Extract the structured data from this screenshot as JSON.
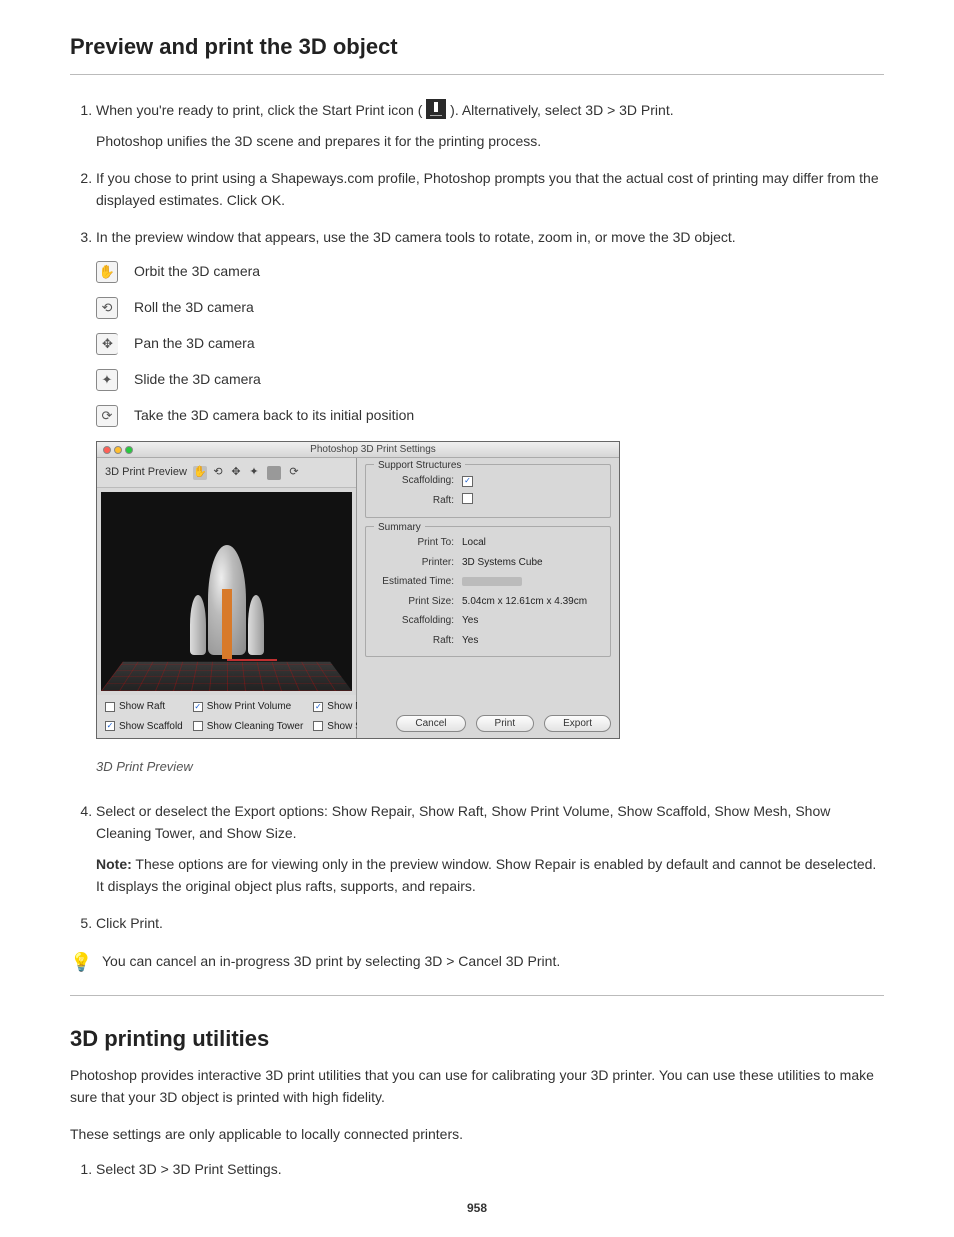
{
  "section1": {
    "title": "Preview and print the 3D object",
    "steps": [
      {
        "pre": "When you're ready to print, click the Start Print icon (",
        "post": " ). Alternatively, select 3D > 3D Print.",
        "nested": "Photoshop unifies the 3D scene and prepares it for the printing process.",
        "icon_alt": "Start Print icon"
      },
      {
        "text": "If you chose to print using a Shapeways.com profile, Photoshop prompts you that the actual cost of printing may differ from the displayed estimates. Click OK."
      },
      {
        "pre_list": "In the preview window that appears, use the 3D camera tools to rotate, zoom in, or move the 3D object.",
        "tools": [
          {
            "glyph": "✋",
            "border": "",
            "label": "Orbit the 3D camera"
          },
          {
            "glyph": "⟲",
            "border": "",
            "label": "Roll the 3D camera"
          },
          {
            "glyph": "✥",
            "border": "noborder",
            "label": "Pan the 3D camera"
          },
          {
            "glyph": "✦",
            "border": "",
            "label": "Slide the 3D camera"
          },
          {
            "glyph": "⟳",
            "border": "",
            "label": "Take the 3D camera back to its initial position"
          }
        ]
      }
    ],
    "screenshot": {
      "window_title": "Photoshop 3D Print Settings",
      "toolbar_label": "3D Print Preview",
      "checks": {
        "show_raft": {
          "label": "Show Raft",
          "checked": false
        },
        "show_print_volume": {
          "label": "Show Print Volume",
          "checked": true
        },
        "show_mesh": {
          "label": "Show Mesh",
          "checked": true
        },
        "show_scaffold": {
          "label": "Show Scaffold",
          "checked": true
        },
        "show_cleaning_tower": {
          "label": "Show Cleaning Tower",
          "checked": false
        },
        "show_size": {
          "label": "Show Size",
          "checked": false
        }
      },
      "support": {
        "title": "Support Structures",
        "scaffolding_label": "Scaffolding:",
        "scaffolding_checked": true,
        "raft_label": "Raft:",
        "raft_checked": false
      },
      "summary": {
        "title": "Summary",
        "rows": {
          "print_to": {
            "k": "Print To:",
            "v": "Local"
          },
          "printer": {
            "k": "Printer:",
            "v": "3D Systems Cube"
          },
          "estimated_time": {
            "k": "Estimated Time:",
            "v": ""
          },
          "print_size": {
            "k": "Print Size:",
            "v": "5.04cm x 12.61cm x 4.39cm"
          },
          "scaffolding": {
            "k": "Scaffolding:",
            "v": "Yes"
          },
          "raft": {
            "k": "Raft:",
            "v": "Yes"
          }
        }
      },
      "buttons": {
        "cancel": "Cancel",
        "print": "Print",
        "export": "Export"
      }
    },
    "caption": "3D Print Preview",
    "step4": "Select or deselect the Export options: Show Repair, Show Raft, Show Print Volume, Show Scaffold, Show Mesh, Show Cleaning Tower, and Show Size.",
    "note_label": "Note:",
    "note_body": "These options are for viewing only in the preview window. Show Repair is enabled by default and cannot be deselected. It displays the original object plus rafts, supports, and repairs.",
    "step5": "Click Print.",
    "tip": "You can cancel an in-progress 3D print by selecting 3D > Cancel 3D Print."
  },
  "section2": {
    "title": "3D printing utilities",
    "intro": "Photoshop provides interactive 3D print utilities that you can use for calibrating your 3D printer. You can use these utilities to make sure that your 3D object is printed with high fidelity.",
    "intro2": "These settings are only applicable to locally connected printers.",
    "list_start": "1",
    "item1": "Select 3D > 3D Print Settings."
  },
  "page_number": "958"
}
